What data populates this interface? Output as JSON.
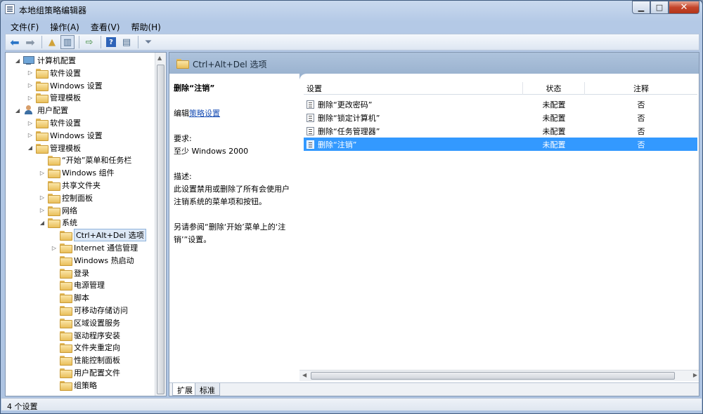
{
  "window": {
    "title": "本地组策略编辑器"
  },
  "menu": [
    "文件(F)",
    "操作(A)",
    "查看(V)",
    "帮助(H)"
  ],
  "tree": [
    {
      "label": "计算机配置",
      "level": 0,
      "toggle": "open",
      "icon": "computer-icon"
    },
    {
      "label": "软件设置",
      "level": 1,
      "toggle": "closed",
      "icon": "folder-icon"
    },
    {
      "label": "Windows 设置",
      "level": 1,
      "toggle": "closed",
      "icon": "folder-icon"
    },
    {
      "label": "管理模板",
      "level": 1,
      "toggle": "closed",
      "icon": "folder-icon"
    },
    {
      "label": "用户配置",
      "level": 0,
      "toggle": "open",
      "icon": "user-icon"
    },
    {
      "label": "软件设置",
      "level": 1,
      "toggle": "closed",
      "icon": "folder-icon"
    },
    {
      "label": "Windows 设置",
      "level": 1,
      "toggle": "closed",
      "icon": "folder-icon"
    },
    {
      "label": "管理模板",
      "level": 1,
      "toggle": "open",
      "icon": "folder-icon"
    },
    {
      "label": "“开始”菜单和任务栏",
      "level": 2,
      "toggle": "none",
      "icon": "folder-icon"
    },
    {
      "label": "Windows 组件",
      "level": 2,
      "toggle": "closed",
      "icon": "folder-icon"
    },
    {
      "label": "共享文件夹",
      "level": 2,
      "toggle": "none",
      "icon": "folder-icon"
    },
    {
      "label": "控制面板",
      "level": 2,
      "toggle": "closed",
      "icon": "folder-icon"
    },
    {
      "label": "网络",
      "level": 2,
      "toggle": "closed",
      "icon": "folder-icon"
    },
    {
      "label": "系统",
      "level": 2,
      "toggle": "open",
      "icon": "folder-icon"
    },
    {
      "label": "Ctrl+Alt+Del 选项",
      "level": 3,
      "toggle": "none",
      "icon": "folder-icon",
      "selected": true
    },
    {
      "label": "Internet 通信管理",
      "level": 3,
      "toggle": "closed",
      "icon": "folder-icon"
    },
    {
      "label": "Windows 热启动",
      "level": 3,
      "toggle": "none",
      "icon": "folder-icon"
    },
    {
      "label": "登录",
      "level": 3,
      "toggle": "none",
      "icon": "folder-icon"
    },
    {
      "label": "电源管理",
      "level": 3,
      "toggle": "none",
      "icon": "folder-icon"
    },
    {
      "label": "脚本",
      "level": 3,
      "toggle": "none",
      "icon": "folder-icon"
    },
    {
      "label": "可移动存储访问",
      "level": 3,
      "toggle": "none",
      "icon": "folder-icon"
    },
    {
      "label": "区域设置服务",
      "level": 3,
      "toggle": "none",
      "icon": "folder-icon"
    },
    {
      "label": "驱动程序安装",
      "level": 3,
      "toggle": "none",
      "icon": "folder-icon"
    },
    {
      "label": "文件夹重定向",
      "level": 3,
      "toggle": "none",
      "icon": "folder-icon"
    },
    {
      "label": "性能控制面板",
      "level": 3,
      "toggle": "none",
      "icon": "folder-icon"
    },
    {
      "label": "用户配置文件",
      "level": 3,
      "toggle": "none",
      "icon": "folder-icon"
    },
    {
      "label": "组策略",
      "level": 3,
      "toggle": "none",
      "icon": "folder-icon"
    }
  ],
  "panel": {
    "title": "Ctrl+Alt+Del 选项"
  },
  "description": {
    "title": "删除“注销”",
    "edit_prefix": "编辑",
    "edit_link": "策略设置",
    "requirement_label": "要求:",
    "requirement_value": "至少 Windows 2000",
    "desc_label": "描述:",
    "desc_text": "此设置禁用或删除了所有会使用户注销系统的菜单项和按钮。",
    "see_also": "另请参阅“删除‘开始’菜单上的‘注销’”设置。"
  },
  "columns": {
    "setting": "设置",
    "state": "状态",
    "note": "注释"
  },
  "rows": [
    {
      "setting": "删除“更改密码”",
      "state": "未配置",
      "note": "否"
    },
    {
      "setting": "删除“锁定计算机”",
      "state": "未配置",
      "note": "否"
    },
    {
      "setting": "删除“任务管理器”",
      "state": "未配置",
      "note": "否"
    },
    {
      "setting": "删除“注销”",
      "state": "未配置",
      "note": "否",
      "selected": true
    }
  ],
  "tabs": [
    "扩展",
    "标准"
  ],
  "status": "4 个设置"
}
